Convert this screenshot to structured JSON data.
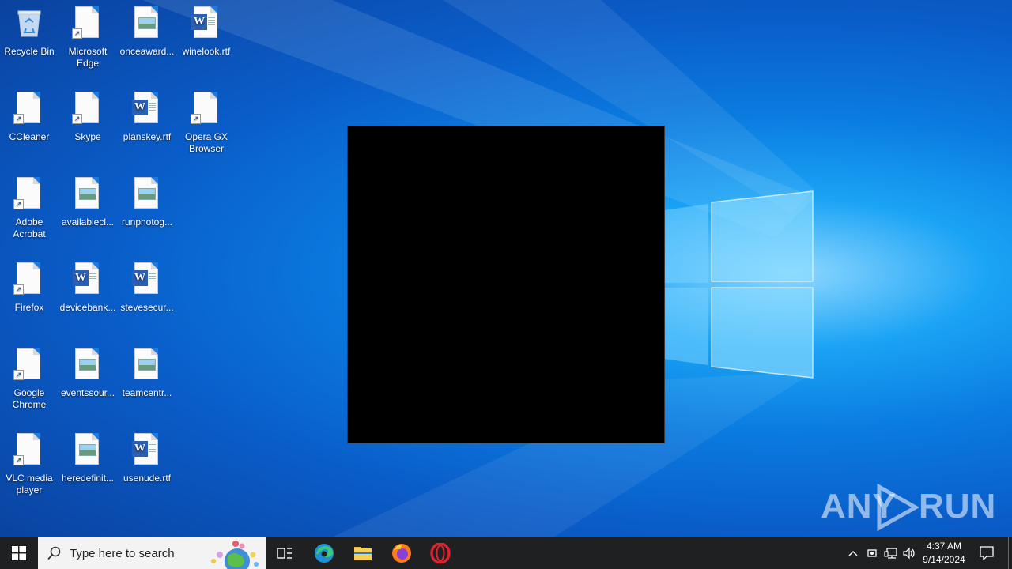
{
  "desktop": {
    "icons": [
      {
        "label": "Recycle Bin",
        "type": "recycle-bin"
      },
      {
        "label": "Microsoft Edge",
        "type": "shortcut"
      },
      {
        "label": "onceaward...",
        "type": "image"
      },
      {
        "label": "winelook.rtf",
        "type": "word"
      },
      {
        "label": "CCleaner",
        "type": "shortcut"
      },
      {
        "label": "Skype",
        "type": "shortcut"
      },
      {
        "label": "planskey.rtf",
        "type": "word"
      },
      {
        "label": "Opera GX Browser",
        "type": "shortcut"
      },
      {
        "label": "Adobe Acrobat",
        "type": "shortcut"
      },
      {
        "label": "availablecl...",
        "type": "image"
      },
      {
        "label": "runphotog...",
        "type": "image"
      },
      {
        "label": "Firefox",
        "type": "shortcut"
      },
      {
        "label": "devicebank...",
        "type": "word"
      },
      {
        "label": "stevesecur...",
        "type": "word"
      },
      {
        "label": "Google Chrome",
        "type": "shortcut"
      },
      {
        "label": "eventssour...",
        "type": "image"
      },
      {
        "label": "teamcentr...",
        "type": "image"
      },
      {
        "label": "VLC media player",
        "type": "shortcut"
      },
      {
        "label": "heredefinit...",
        "type": "image"
      },
      {
        "label": "usenude.rtf",
        "type": "word"
      }
    ]
  },
  "watermark": {
    "left": "ANY",
    "right": "RUN"
  },
  "taskbar": {
    "search_placeholder": "Type here to search",
    "pinned": [
      "task-view-icon",
      "edge-icon",
      "file-explorer-icon",
      "firefox-icon",
      "opera-icon"
    ],
    "clock_time": "4:37 AM",
    "clock_date": "9/14/2024"
  },
  "colors": {
    "desktop_blue": "#0a7be0",
    "taskbar": "#1f2022",
    "word_blue": "#2b5fb3"
  }
}
